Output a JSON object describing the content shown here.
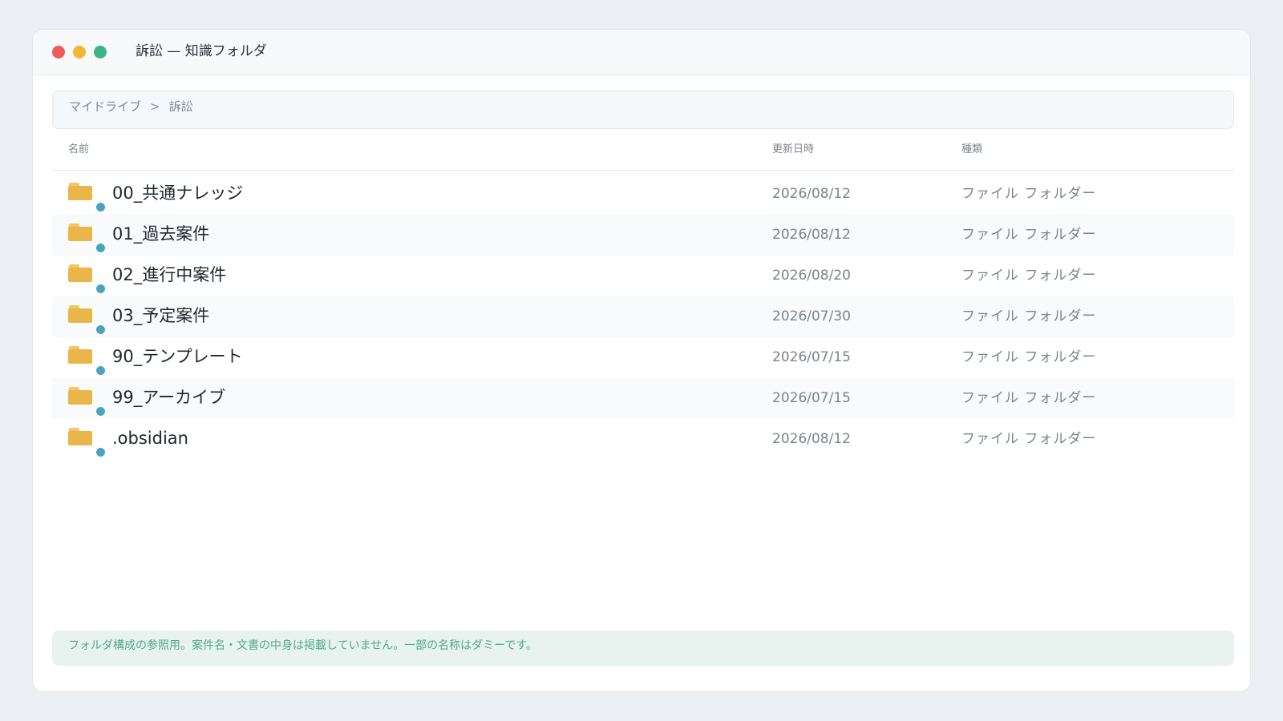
{
  "window": {
    "title": "訴訟 — 知識フォルダ"
  },
  "breadcrumb": {
    "items": [
      "マイドライブ",
      "訴訟"
    ],
    "separator": ">"
  },
  "table": {
    "headers": {
      "name": "名前",
      "date": "更新日時",
      "type": "種類"
    },
    "rows": [
      {
        "name": "00_共通ナレッジ",
        "date": "2026/08/12",
        "type": "ファイル フォルダー",
        "icon": "folder-icon"
      },
      {
        "name": "01_過去案件",
        "date": "2026/08/12",
        "type": "ファイル フォルダー",
        "icon": "folder-icon"
      },
      {
        "name": "02_進行中案件",
        "date": "2026/08/20",
        "type": "ファイル フォルダー",
        "icon": "folder-icon"
      },
      {
        "name": "03_予定案件",
        "date": "2026/07/30",
        "type": "ファイル フォルダー",
        "icon": "folder-icon"
      },
      {
        "name": "90_テンプレート",
        "date": "2026/07/15",
        "type": "ファイル フォルダー",
        "icon": "folder-icon"
      },
      {
        "name": "99_アーカイブ",
        "date": "2026/07/15",
        "type": "ファイル フォルダー",
        "icon": "folder-icon"
      },
      {
        "name": ".obsidian",
        "date": "2026/08/12",
        "type": "ファイル フォルダー",
        "icon": "folder-icon"
      }
    ]
  },
  "footer": {
    "note": "フォルダ構成の参照用。案件名・文書の中身は掲載していません。一部の名称はダミーです。"
  },
  "colors": {
    "folder": "#eab649",
    "sync_status": "#4aa3bf",
    "note_text": "#51a98c",
    "note_background": "#e8f2ef"
  }
}
